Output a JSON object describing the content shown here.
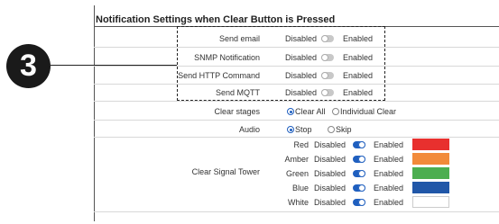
{
  "title": "Notification Settings when Clear Button is Pressed",
  "callout": "3",
  "disabled": "Disabled",
  "enabled": "Enabled",
  "notifications": [
    {
      "label": "Send email",
      "enabled": false
    },
    {
      "label": "SNMP Notification",
      "enabled": false
    },
    {
      "label": "Send HTTP Command",
      "enabled": false
    },
    {
      "label": "Send MQTT",
      "enabled": false
    }
  ],
  "clear_stages": {
    "label": "Clear stages",
    "options": [
      "Clear All",
      "Individual Clear"
    ],
    "selected": "Clear All"
  },
  "audio": {
    "label": "Audio",
    "options": [
      "Stop",
      "Skip"
    ],
    "selected": "Stop"
  },
  "signal_tower": {
    "label": "Clear Signal Tower",
    "colors": [
      {
        "name": "Red",
        "enabled": true,
        "swatch": "#e8302e"
      },
      {
        "name": "Amber",
        "enabled": true,
        "swatch": "#f28a3a"
      },
      {
        "name": "Green",
        "enabled": true,
        "swatch": "#4cae50"
      },
      {
        "name": "Blue",
        "enabled": true,
        "swatch": "#2157a8"
      },
      {
        "name": "White",
        "enabled": true,
        "swatch": "#ffffff"
      }
    ]
  }
}
